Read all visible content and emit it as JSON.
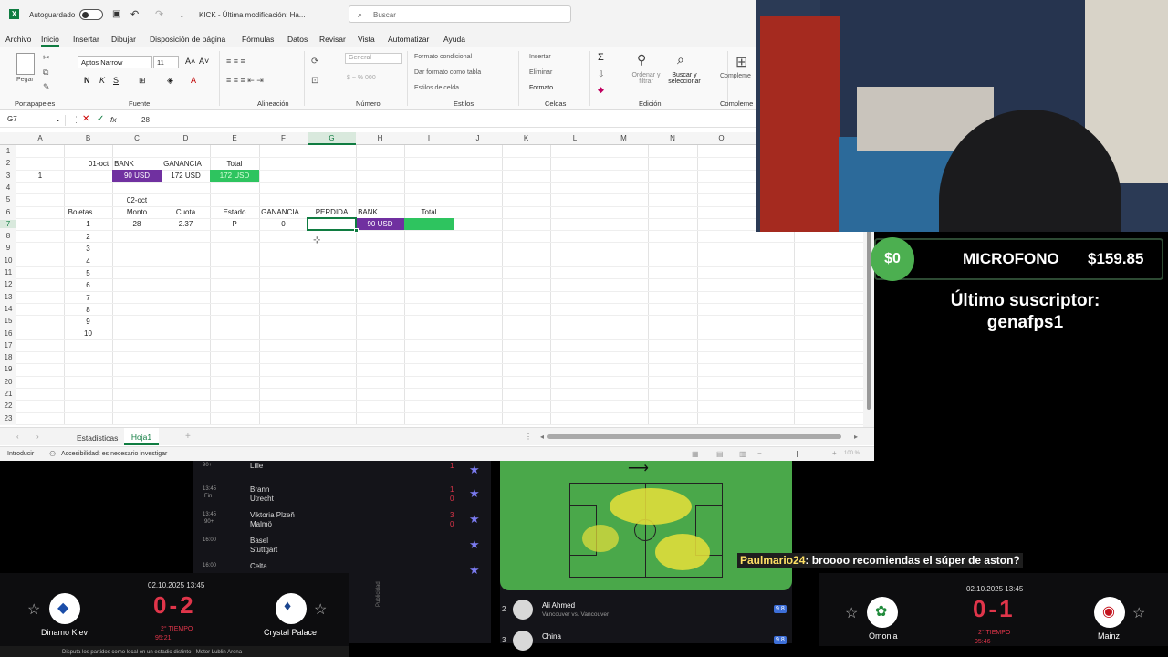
{
  "excel": {
    "autosave_label": "Autoguardado",
    "doc_title": "KICK - Última modificación: Ha...",
    "search_placeholder": "Buscar",
    "menus": [
      "Archivo",
      "Inicio",
      "Insertar",
      "Dibujar",
      "Disposición de página",
      "Fórmulas",
      "Datos",
      "Revisar",
      "Vista",
      "Automatizar",
      "Ayuda"
    ],
    "ribbon": {
      "font_name": "Aptos Narrow",
      "font_size": "11",
      "number_format": "General",
      "groups": [
        "Portapapeles",
        "Fuente",
        "Alineación",
        "Número",
        "Estilos",
        "Celdas",
        "Edición",
        "Compleme"
      ],
      "paste_label": "Pegar",
      "styles": [
        "Formato condicional",
        "Dar formato como tabla",
        "Estilos de celda"
      ],
      "cells": [
        "Insertar",
        "Eliminar",
        "Formato"
      ],
      "edit": [
        "Ordenar y filtrar",
        "Buscar y seleccionar"
      ]
    },
    "name_box": "G7",
    "formula_value": "28",
    "columns": [
      "A",
      "B",
      "C",
      "D",
      "E",
      "F",
      "G",
      "H",
      "I",
      "J",
      "K",
      "L",
      "M",
      "N",
      "O"
    ],
    "rows": [
      "1",
      "2",
      "3",
      "4",
      "5",
      "6",
      "7",
      "8",
      "9",
      "10",
      "11",
      "12",
      "13",
      "14",
      "15",
      "16",
      "17",
      "18",
      "19",
      "20",
      "21",
      "22",
      "23"
    ],
    "cells": {
      "b2": "01-oct",
      "c2": "BANK",
      "d2": "GANANCIA",
      "e2": "Total",
      "a3": "1",
      "c3": "90 USD",
      "d3": "172 USD",
      "e3": "172 USD",
      "c5": "02-oct",
      "b6": "Boletas",
      "c6": "Monto",
      "d6": "Cuota",
      "e6": "Estado",
      "f6": "GANANCIA",
      "g6": "PERDIDA",
      "h6": "BANK",
      "i6": "Total",
      "b7": "1",
      "c7": "28",
      "d7": "2.37",
      "e7": "P",
      "f7": "0",
      "h7": "90 USD",
      "boletas": [
        "2",
        "3",
        "4",
        "5",
        "6",
        "7",
        "8",
        "9",
        "10"
      ]
    },
    "sheet_tabs": [
      "Estadisticas",
      "Hoja1"
    ],
    "status_left": "Introducir",
    "status_access": "Accesibilidad: es necesario investigar",
    "zoom": "100 %",
    "colors": {
      "purple": "#7030a0",
      "green": "#2ec45f",
      "excel": "#107c41"
    }
  },
  "overlay": {
    "donation_amount": "$0",
    "donation_label": "MICROFONO",
    "donation_goal": "$159.85",
    "last_sub_title": "Último suscriptor:",
    "last_sub_name": "genafps1"
  },
  "matches": [
    {
      "time": "90+",
      "status": "",
      "home": "Lille",
      "away": "",
      "hs": "1",
      "as": ""
    },
    {
      "time": "13:45",
      "status": "Fin",
      "home": "Brann",
      "away": "Utrecht",
      "hs": "1",
      "as": "0"
    },
    {
      "time": "13:45",
      "status": "90+",
      "home": "Viktoria Plzeň",
      "away": "Malmö",
      "hs": "3",
      "as": "0"
    },
    {
      "time": "16:00",
      "status": "",
      "home": "Basel",
      "away": "Stuttgart",
      "hs": "",
      "as": ""
    },
    {
      "time": "16:00",
      "status": "",
      "home": "Celta",
      "away": "",
      "hs": "",
      "as": ""
    }
  ],
  "published_label": "Publicidad",
  "players": [
    {
      "rank": "2",
      "name": "Ali Ahmed",
      "sub": "Vancouver vs. Vancouver",
      "rating": "9.8"
    },
    {
      "rank": "3",
      "name": "China",
      "sub": "",
      "rating": "9.8"
    }
  ],
  "chat": {
    "user": "Paulmario24",
    "message": ": broooo recomiendas el súper de aston?"
  },
  "left_match": {
    "date": "02.10.2025 13:45",
    "score": "0-2",
    "status": "2° TIEMPO",
    "minute": "95:21",
    "home": "Dinamo Kiev",
    "away": "Crystal Palace"
  },
  "right_match": {
    "date": "02.10.2025 13:45",
    "score": "0-1",
    "status": "2° TIEMPO",
    "minute": "95:46",
    "home": "Omonia",
    "away": "Mainz"
  },
  "ticker": "Disputa los partidos como local en un estadio distinto - Motor Lublin Arena"
}
